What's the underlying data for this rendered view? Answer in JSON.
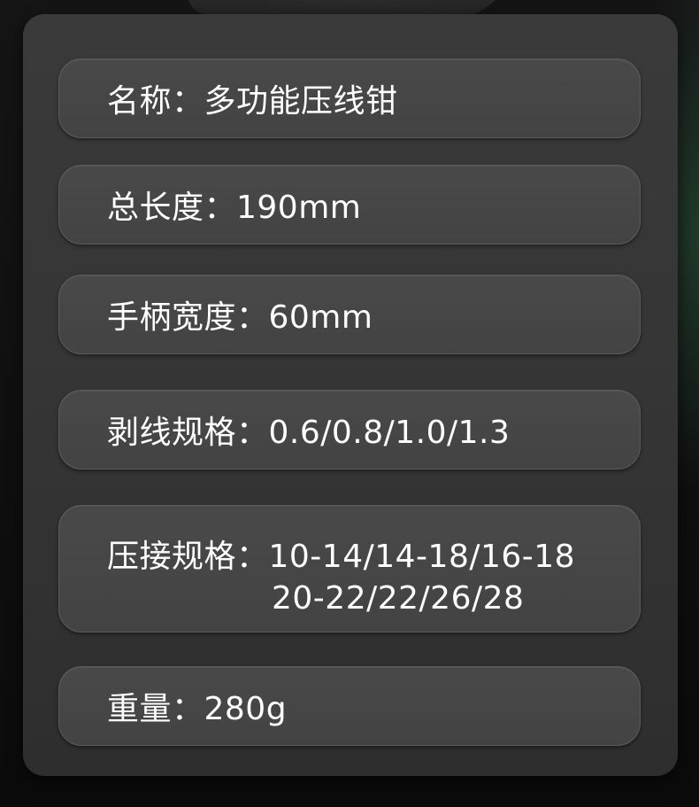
{
  "specs": {
    "name": "名称：多功能压线钳",
    "total_length": "总长度：190mm",
    "handle_width": "手柄宽度：60mm",
    "strip_spec": "剥线规格：0.6/0.8/1.0/1.3",
    "crimp_spec_line1": "压接规格：10-14/14-18/16-18",
    "crimp_spec_line2": "20-22/22/26/28",
    "weight": "重量：280g"
  }
}
